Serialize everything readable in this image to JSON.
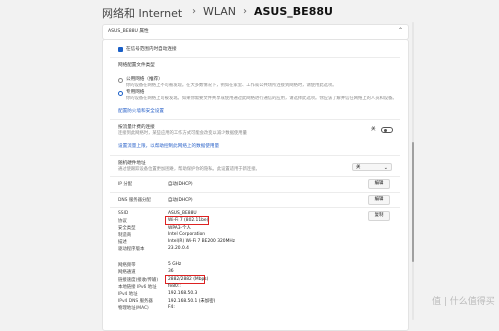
{
  "breadcrumb": {
    "level1": "网络和 Internet",
    "level2": "WLAN",
    "level3": "ASUS_BE88U"
  },
  "header_card": {
    "title": "ASUS_BE88U 属性"
  },
  "auto_connect": {
    "label": "在信号范围内时自动连接"
  },
  "profile": {
    "heading": "网络配置文件类型",
    "public_label": "公用网络（推荐）",
    "public_desc": "你的设备在网络上不可被发现。在大多数情况下，例如在家里、工作或公共场所连接到网络时，请使用此选项。",
    "private_label": "专用网络",
    "private_desc": "你的设备在网络上可被发现。如果你需要文件共享或使用通过此网络进行通信的应用，请选择此选项。你应该了解并信任网络上的人员和设备。",
    "firewall_link": "配置防火墙和安全设置"
  },
  "metered": {
    "heading": "按流量计费的连接",
    "desc": "连接到此网络时，某些应用的工作方式可能会改变以减少数据使用量",
    "toggle_label": "关",
    "link": "设置流量上限，以帮助控制此网络上的数据使用量"
  },
  "random_mac": {
    "heading": "随机硬件地址",
    "desc": "通过使跟踪设备位置更加困难，帮助保护你的隐私。此设置适用于新连接。",
    "select_value": "关"
  },
  "ip": {
    "ip_label": "IP 分配",
    "ip_value": "自动(DHCP)",
    "ip_button": "编辑",
    "dns_label": "DNS 服务器分配",
    "dns_value": "自动(DHCP)",
    "dns_button": "编辑"
  },
  "props": {
    "rows": [
      {
        "label": "SSID",
        "value": "ASUS_BE88U"
      },
      {
        "label": "协议",
        "value": "Wi-Fi 7 (802.11be)"
      },
      {
        "label": "安全类型",
        "value": "WPA3-个人"
      },
      {
        "label": "制造商",
        "value": "Intel Corporation"
      },
      {
        "label": "描述",
        "value": "Intel(R) Wi-Fi 7 BE200 320MHz"
      },
      {
        "label": "驱动程序版本",
        "value": "23.20.0.4"
      }
    ],
    "copy_button": "复制"
  },
  "net": {
    "rows": [
      {
        "label": "网络频带",
        "value": "5 GHz"
      },
      {
        "label": "网络通道",
        "value": "36"
      },
      {
        "label": "链接速度(接收/传输)",
        "value": "2882/2882 (Mbps)"
      },
      {
        "label": "本地链接 IPv6 地址",
        "value": "fe80::"
      },
      {
        "label": "IPv4 地址",
        "value": "192.168.50.3"
      },
      {
        "label": "IPv4 DNS 服务器",
        "value": "192.168.50.1 (未加密)"
      },
      {
        "label": "物理地址(MAC)",
        "value": "F4:"
      }
    ]
  },
  "watermark": {
    "text": "值 | 什么值得买"
  }
}
